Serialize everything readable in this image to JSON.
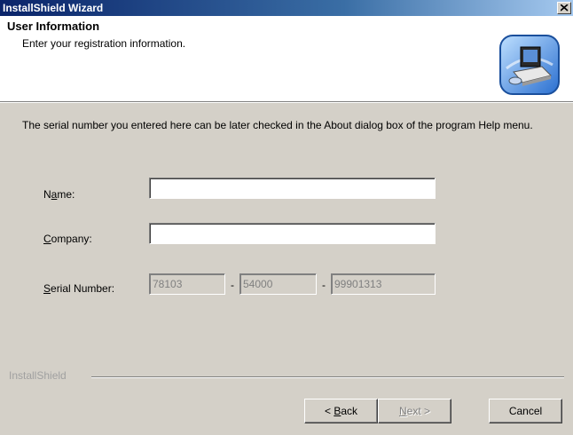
{
  "window": {
    "title": "InstallShield Wizard"
  },
  "header": {
    "title": "User Information",
    "subtitle": "Enter your registration information.",
    "icon": "computer-setup-icon"
  },
  "description": "The serial number you entered here can be later checked in the About dialog box of the program Help menu.",
  "form": {
    "name_label_pre": "N",
    "name_label_ul": "a",
    "name_label_post": "me:",
    "name_value": "",
    "company_label_ul": "C",
    "company_label_post": "ompany:",
    "company_value": "",
    "serial_label_ul": "S",
    "serial_label_post": "erial Number:",
    "serial_parts": [
      "78103",
      "54000",
      "99901313"
    ],
    "serial_separator": "-"
  },
  "footer": {
    "brand": "InstallShield",
    "back_label_pre": "< ",
    "back_label_ul": "B",
    "back_label_post": "ack",
    "next_label_ul": "N",
    "next_label_post": "ext >",
    "cancel_label": "Cancel"
  }
}
